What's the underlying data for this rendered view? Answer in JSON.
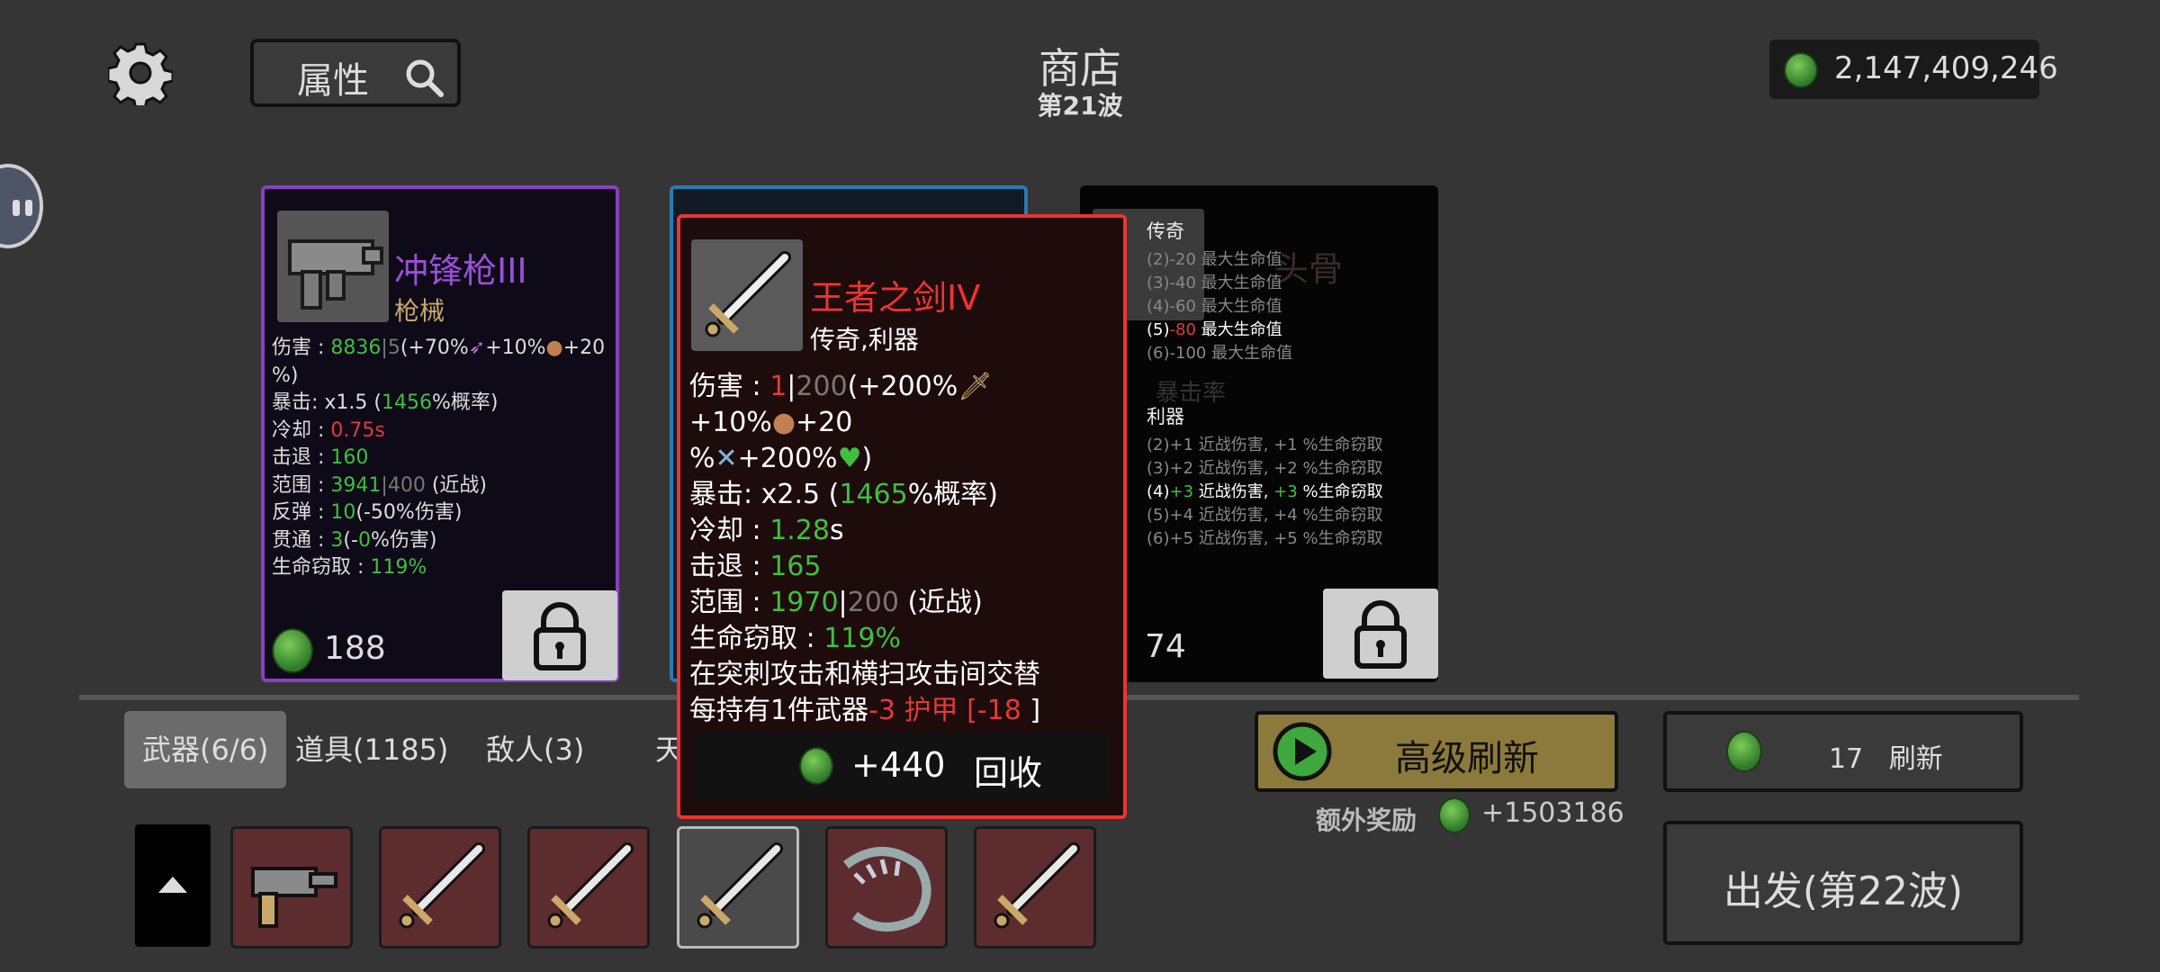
{
  "header": {
    "search_label": "属性",
    "title": "商店",
    "wave": "第21波",
    "money": "2,147,409,246"
  },
  "cards": [
    {
      "name": "冲锋枪III",
      "type": "枪械",
      "price": "188",
      "stats": [
        [
          "伤害 : ",
          "8836",
          "|",
          "5",
          "(+70%",
          "+10%",
          "+20"
        ],
        [
          "%)"
        ],
        [
          "暴击:  x1.5  (",
          "1456",
          "%概率)"
        ],
        [
          "冷却 : ",
          "0.75s"
        ],
        [
          "击退 : ",
          "160"
        ],
        [
          "范围 : ",
          "3941",
          "|",
          "400",
          " (近战)"
        ],
        [
          "反弹 : ",
          "10",
          "(-50%伤害)"
        ],
        [
          "贯通 : ",
          "3",
          "(-",
          "0",
          "%伤害)"
        ],
        [
          "生命窃取 : ",
          "119%"
        ]
      ]
    },
    {
      "price": "74"
    }
  ],
  "tooltip": {
    "name": "王者之剑IV",
    "type": "传奇,利器",
    "line1": [
      "伤害 : ",
      "1",
      "|",
      "200",
      "(+200%",
      "+10%",
      "+20"
    ],
    "line2": [
      "%",
      "+200%",
      ")"
    ],
    "line3": [
      "暴击:  x2.5  (",
      "1465",
      "%概率)"
    ],
    "line4": [
      "冷却 : ",
      "1.28",
      "s"
    ],
    "line5": [
      "击退 : ",
      "165"
    ],
    "line6": [
      "范围 : ",
      "1970",
      "|",
      "200",
      " (近战)"
    ],
    "line7": [
      "生命窃取 : ",
      "119%"
    ],
    "line8": "在突刺攻击和横扫攻击间交替",
    "line9": [
      "每持有1件武器",
      "-3 护甲 [",
      "-18",
      " ]"
    ],
    "recycle_value": "+440",
    "recycle_label": "回收"
  },
  "set_bonus": {
    "legend_title": "传奇",
    "legend": [
      "(2)-20 最大生命值",
      "(3)-40 最大生命值",
      "(4)-60 最大生命值",
      "(5)",
      "-80",
      " 最大生命值",
      "(6)-100 最大生命值"
    ],
    "sharp_title": "利器",
    "sharp": [
      "(2)+1 近战伤害, +1 %生命窃取",
      "(3)+2 近战伤害, +2 %生命窃取",
      "(4)",
      "+3",
      " 近战伤害, ",
      "+3",
      " %生命窃取",
      "(5)+4 近战伤害, +4 %生命窃取",
      "(6)+5 近战伤害, +5 %生命窃取"
    ],
    "bg_fragment_1": "头骨",
    "bg_fragment_2": "暴击率"
  },
  "tabs": [
    "武器(6/6)",
    "道具(1185)",
    "敌人(3)",
    "天"
  ],
  "buttons": {
    "advanced_refresh": "高级刷新",
    "bonus_label": "额外奖励",
    "bonus_value": "+1503186",
    "refresh_cost": "17",
    "refresh_label": "刷新",
    "go": "出发(第22波)"
  },
  "colors": {
    "accent_green": "#3fbf3f",
    "accent_red": "#e23a3a",
    "gold": "#8c7a3c"
  }
}
